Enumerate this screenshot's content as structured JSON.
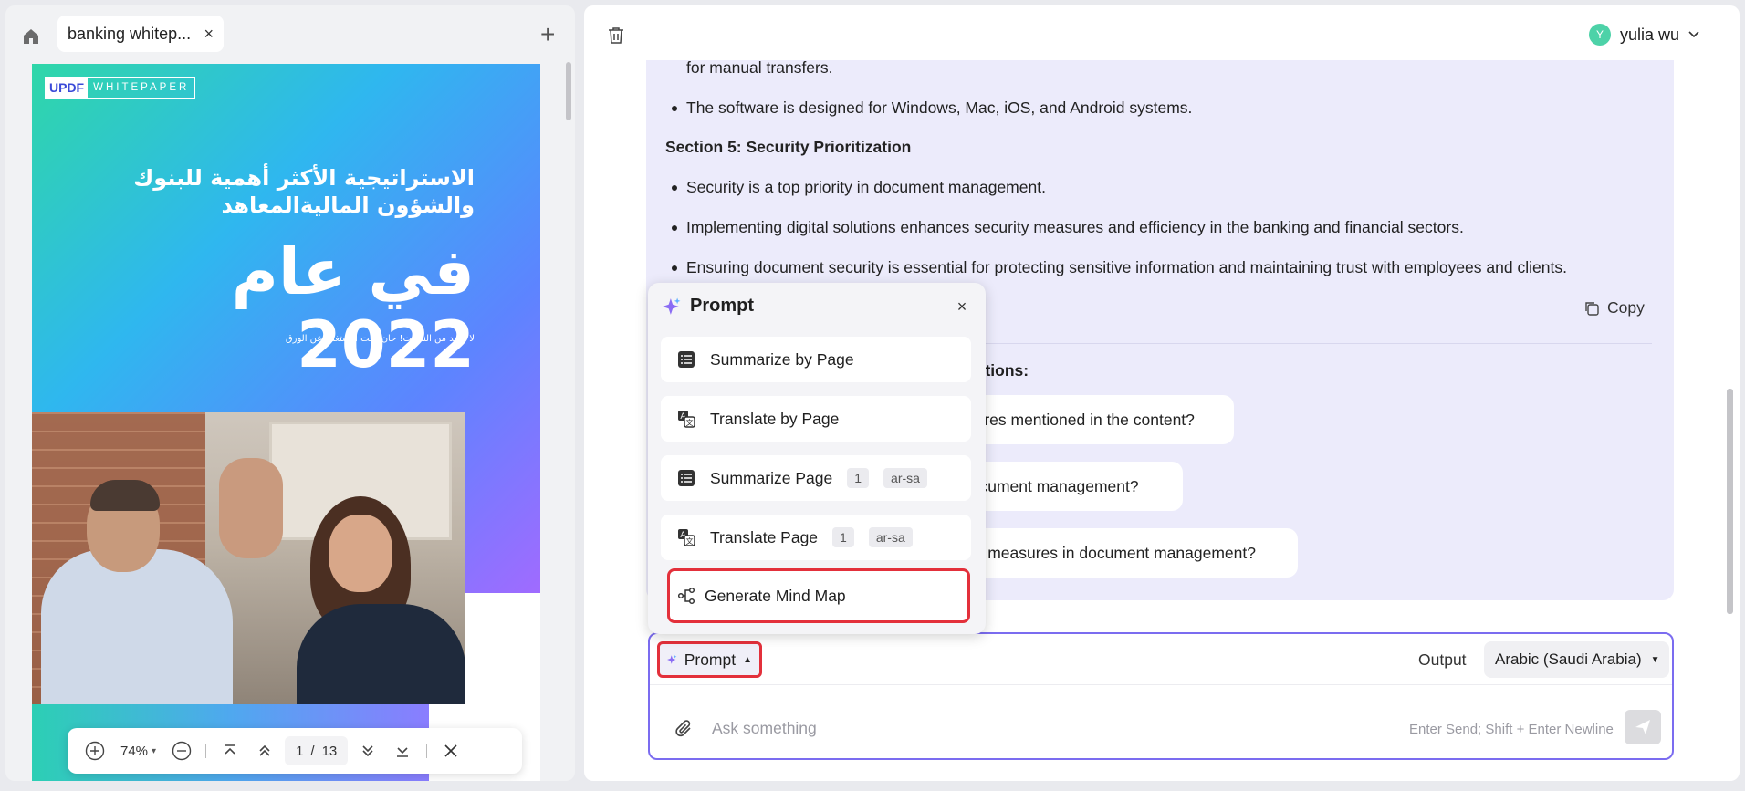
{
  "left": {
    "tab_title": "banking whitep...",
    "tab_close": "×",
    "add_tab": "+",
    "cover": {
      "logo_updf": "UPDF",
      "logo_whitepaper": "WHITEPAPER",
      "arabic_title": "الاستراتيجية الأكثر أهمية للبنوك والشؤون الماليةالمعاهد",
      "arabic_big": "في عام 2022",
      "arabic_sub": "لا مزيد من النفقات! حان وقت الاستغناء عن الورق"
    },
    "toolbar": {
      "zoom": "74%",
      "page_current": "1",
      "page_sep": "/",
      "page_total": "13"
    }
  },
  "right": {
    "user_initial": "Y",
    "user_name": "yulia wu",
    "content": {
      "line_partial": "for manual transfers.",
      "bullet_os": "The software is designed for Windows, Mac, iOS, and Android systems.",
      "section5_heading": "Section 5: Security Prioritization",
      "bullet_sec1": "Security is a top priority in document management.",
      "bullet_sec2": "Implementing digital solutions enhances security measures and efficiency in the banking and financial sectors.",
      "bullet_sec3": "Ensuring document security is essential for protecting sensitive information and maintaining trust with employees and clients."
    },
    "copy_label": "Copy",
    "suggestions_heading": "estions:",
    "suggestions": [
      "atures mentioned in the content?",
      "document management?",
      "rity measures in document management?"
    ],
    "input": {
      "prompt_label": "Prompt",
      "output_label": "Output",
      "output_value": "Arabic (Saudi Arabia)",
      "placeholder": "Ask something",
      "hint": "Enter Send; Shift + Enter Newline"
    },
    "prompt_popup": {
      "title": "Prompt",
      "close": "×",
      "items": [
        {
          "label": "Summarize by Page"
        },
        {
          "label": "Translate by Page"
        },
        {
          "label": "Summarize Page",
          "page": "1",
          "lang": "ar-sa"
        },
        {
          "label": "Translate Page",
          "page": "1",
          "lang": "ar-sa"
        },
        {
          "label": "Generate Mind Map"
        }
      ]
    }
  },
  "colors": {
    "accent": "#7b6cf0",
    "highlight": "#e3303b",
    "chat_bubble": "#ecebfb"
  }
}
